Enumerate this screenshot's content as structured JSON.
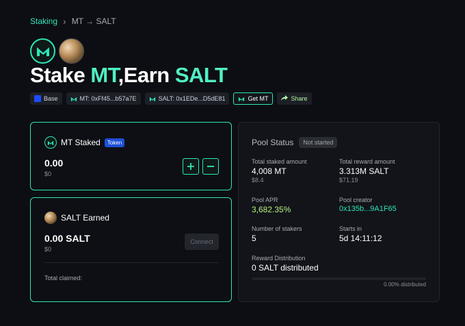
{
  "breadcrumb": {
    "root": "Staking",
    "current": "MT → SALT"
  },
  "headline": {
    "prefix": "Stake ",
    "stake_token": "MT",
    "middle": ",Earn ",
    "reward_token": "SALT"
  },
  "chips": {
    "network": "Base",
    "mt_address": "MT: 0xFf45...b57a7E",
    "salt_address": "SALT: 0x1EDe...D5dE81",
    "get_mt": "Get MT",
    "share": "Share"
  },
  "staked": {
    "title": "MT Staked",
    "badge": "Token",
    "amount": "0.00",
    "usd": "$0"
  },
  "earned": {
    "title": "SALT Earned",
    "amount": "0.00 SALT",
    "usd": "$0",
    "connect_label": "Connect",
    "claimed_label": "Total claimed:"
  },
  "pool": {
    "title": "Pool Status",
    "status": "Not started",
    "total_staked_label": "Total staked amount",
    "total_staked_value": "4,008 MT",
    "total_staked_usd": "$8.4",
    "total_reward_label": "Total reward amount",
    "total_reward_value": "3.313M SALT",
    "total_reward_usd": "$71.19",
    "apr_label": "Pool APR",
    "apr_value": "3,682.35%",
    "creator_label": "Pool creator",
    "creator_value": "0x135b...9A1F65",
    "stakers_label": "Number of stakers",
    "stakers_value": "5",
    "starts_label": "Starts in",
    "starts_value": "5d 14:11:12",
    "distribution_label": "Reward Distribution",
    "distribution_value": "0 SALT distributed",
    "distributed_pct_label": "0.00% distributed",
    "distributed_fraction": 0
  },
  "colors": {
    "accent": "#2ee6b8",
    "apr_green": "#b7f07a",
    "token_badge": "#1d4fd6"
  },
  "icons": {
    "mt_logo": "mt-logo-icon",
    "salt_logo": "salt-logo-icon",
    "plus": "plus-icon",
    "minus": "minus-icon",
    "share": "share-arrow-icon"
  }
}
